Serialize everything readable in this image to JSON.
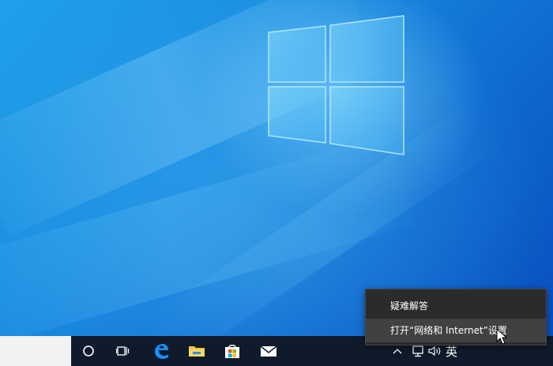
{
  "context_menu": {
    "items": [
      {
        "label": "疑难解答"
      },
      {
        "label": "打开“网络和 Internet”设置"
      }
    ]
  },
  "tray": {
    "input_language": "英"
  },
  "taskbar": {
    "pinned_apps": [
      "cortana-icon",
      "task-view-icon",
      "edge-icon",
      "file-explorer-icon",
      "store-icon",
      "mail-icon"
    ]
  },
  "colors": {
    "desktop_blue": "#1687de",
    "taskbar": "#0f1b2b",
    "menu_bg": "#2b2b2b",
    "menu_hover": "#414141",
    "edge_blue": "#1a8cff",
    "folder_yellow": "#f4c441"
  }
}
